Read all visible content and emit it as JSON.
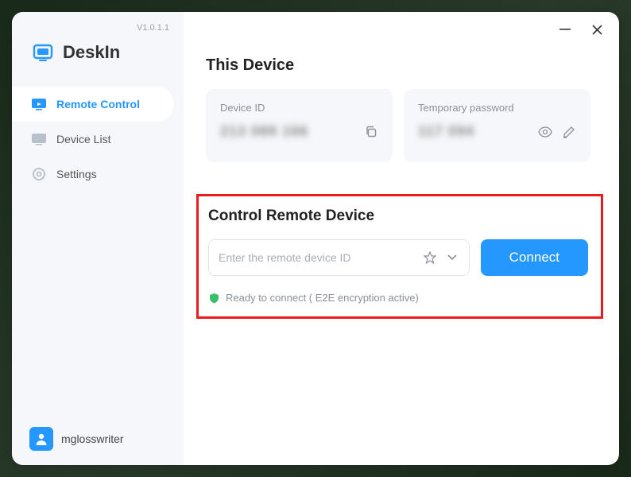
{
  "version": "V1.0.1.1",
  "brand": "DeskIn",
  "sidebar": {
    "items": [
      {
        "label": "Remote Control"
      },
      {
        "label": "Device List"
      },
      {
        "label": "Settings"
      }
    ]
  },
  "user": {
    "name": "mglosswriter"
  },
  "this_device": {
    "title": "This Device",
    "id_label": "Device ID",
    "id_value": "213 089 166",
    "pw_label": "Temporary password",
    "pw_value": "117 094"
  },
  "remote": {
    "title": "Control Remote Device",
    "placeholder": "Enter the remote device ID",
    "connect_label": "Connect",
    "status": "Ready to connect ( E2E encryption active)"
  }
}
